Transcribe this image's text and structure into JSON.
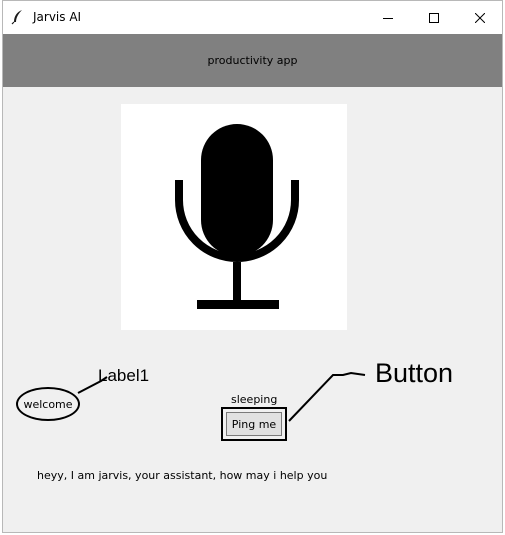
{
  "window": {
    "title": "Jarvis AI",
    "app_icon": "feather-icon",
    "controls": [
      "minimize-icon",
      "maximize-icon",
      "close-icon"
    ]
  },
  "header": {
    "text": "productivity app",
    "background": "#808080"
  },
  "mic": {
    "icon": "microphone-icon"
  },
  "welcome": {
    "text": "welcome"
  },
  "status": {
    "text": "sleeping"
  },
  "ping_button": {
    "label": "Ping me"
  },
  "message": {
    "text": "heyy, I am jarvis, your assistant, how may i help you"
  },
  "annotations": {
    "label1": "Label1",
    "button": "Button"
  }
}
